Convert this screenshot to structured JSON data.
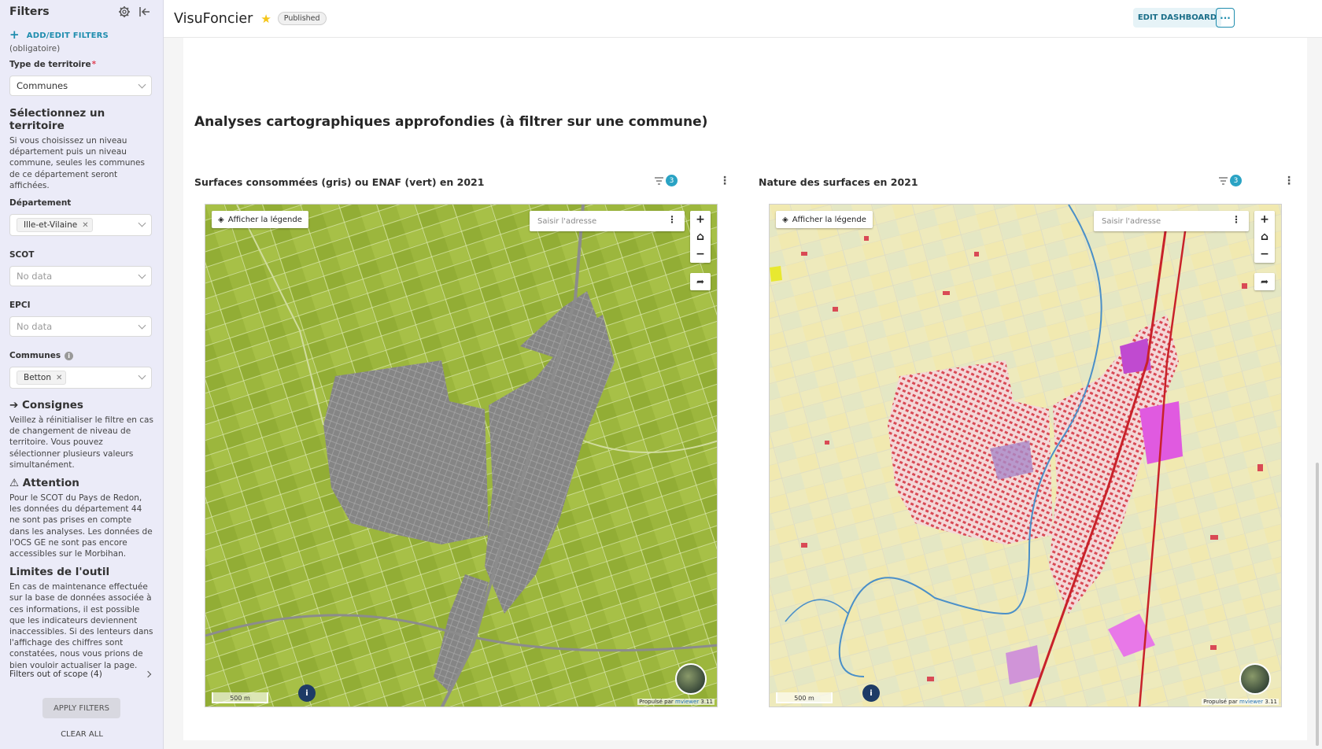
{
  "sidebar": {
    "title": "Filters",
    "add_edit_label": "ADD/EDIT FILTERS",
    "obligatoire_note": "(obligatoire)",
    "type_label": "Type de territoire",
    "type_required_mark": "*",
    "type_value": "Communes",
    "select_territory_heading": "Sélectionnez un territoire",
    "select_territory_text": "Si vous choisissez un niveau département puis un niveau commune, seules les communes de ce département seront affichées.",
    "departement_label": "Département",
    "departement_tag": "Ille-et-Vilaine",
    "scot_label": "SCOT",
    "scot_placeholder": "No data",
    "epci_label": "EPCI",
    "epci_placeholder": "No data",
    "communes_label": "Communes",
    "communes_tag": "Betton",
    "consignes_heading": "➔ Consignes",
    "consignes_text": "Veillez à réinitialiser le filtre en cas de changement de niveau de territoire. Vous pouvez sélectionner plusieurs valeurs simultanément.",
    "attention_heading": "⚠ Attention",
    "attention_text": "Pour le SCOT du Pays de Redon, les données du département 44 ne sont pas prises en compte dans les analyses. Les données de l'OCS GE ne sont pas encore accessibles sur le Morbihan.",
    "limites_heading": "Limites de l'outil",
    "limites_text": "En cas de maintenance effectuée sur la base de données associée à ces informations, il est possible que les indicateurs deviennent inaccessibles. Si des lenteurs dans l'affichage des chiffres sont constatées, nous vous prions de bien vouloir actualiser la page.",
    "out_of_scope": "Filters out of scope (4)",
    "apply_label": "APPLY FILTERS",
    "clear_label": "CLEAR ALL"
  },
  "header": {
    "title": "VisuFoncier",
    "status": "Published",
    "edit_label": "EDIT DASHBOARD",
    "more_label": "···"
  },
  "main": {
    "section_title": "Analyses cartographiques approfondies (à filtrer sur une commune)",
    "charts": [
      {
        "title": "Surfaces consommées (gris) ou ENAF (vert) en 2021",
        "filter_count": "3",
        "legend_label": "Afficher la légende",
        "search_placeholder": "Saisir l'adresse",
        "scale_label": "500 m",
        "info_label": "i",
        "powered_prefix": "Propulsé par",
        "powered_link": "mviewer",
        "powered_version": "3.11"
      },
      {
        "title": "Nature des surfaces en 2021",
        "filter_count": "3",
        "legend_label": "Afficher la légende",
        "search_placeholder": "Saisir l'adresse",
        "scale_label": "500 m",
        "info_label": "i",
        "powered_prefix": "Propulsé par",
        "powered_link": "mviewer",
        "powered_version": "3.11"
      }
    ]
  },
  "colors": {
    "accent": "#1f8dae",
    "sidebar_bg": "#ebebf8",
    "enaf_green": "#9bb53a",
    "consumed_gray": "#8a8a8a",
    "land_beige": "#eee9b8",
    "urban_red": "#d94a55",
    "activity_magenta": "#d65ad6",
    "river_blue": "#4a8fc8"
  }
}
